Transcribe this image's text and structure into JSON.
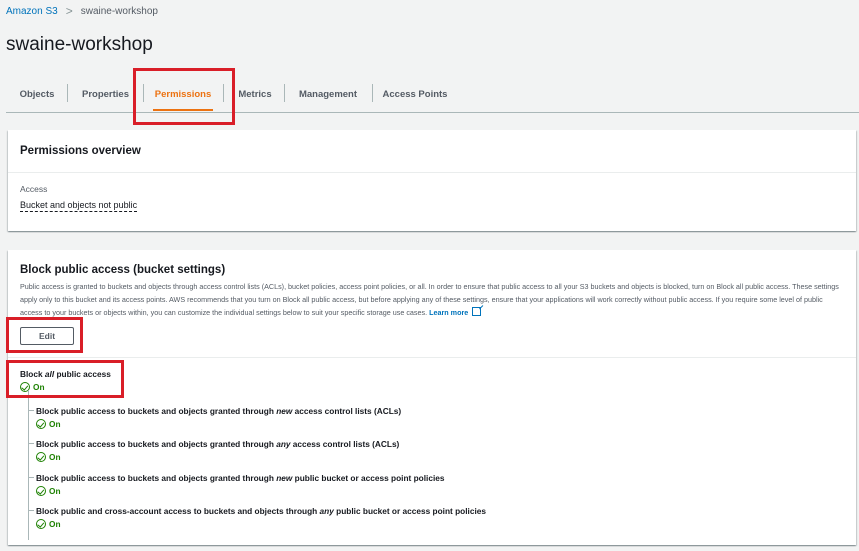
{
  "breadcrumb": {
    "root": "Amazon S3",
    "separator": ">",
    "current": "swaine-workshop"
  },
  "page": {
    "title": "swaine-workshop"
  },
  "tabs": [
    {
      "label": "Objects",
      "active": false
    },
    {
      "label": "Properties",
      "active": false
    },
    {
      "label": "Permissions",
      "active": true
    },
    {
      "label": "Metrics",
      "active": false
    },
    {
      "label": "Management",
      "active": false
    },
    {
      "label": "Access Points",
      "active": false
    }
  ],
  "permissions_overview": {
    "title": "Permissions overview",
    "access_label": "Access",
    "access_value": "Bucket and objects not public"
  },
  "block_public_access": {
    "title": "Block public access (bucket settings)",
    "description": "Public access is granted to buckets and objects through access control lists (ACLs), bucket policies, access point policies, or all. In order to ensure that public access to all your S3 buckets and objects is blocked, turn on Block all public access. These settings apply only to this bucket and its access points. AWS recommends that you turn on Block all public access, but before applying any of these settings, ensure that your applications will work correctly without public access. If you require some level of public access to your buckets or objects within, you can customize the individual settings below to suit your specific storage use cases.",
    "learn_more": "Learn more",
    "edit_label": "Edit",
    "main_setting": {
      "prefix": "Block ",
      "emphasis": "all",
      "suffix": " public access",
      "status": "On"
    },
    "settings": [
      {
        "prefix": "Block public access to buckets and objects granted through ",
        "emphasis": "new",
        "suffix": " access control lists (ACLs)",
        "status": "On"
      },
      {
        "prefix": "Block public access to buckets and objects granted through ",
        "emphasis": "any",
        "suffix": " access control lists (ACLs)",
        "status": "On"
      },
      {
        "prefix": "Block public access to buckets and objects granted through ",
        "emphasis": "new",
        "suffix": " public bucket or access point policies",
        "status": "On"
      },
      {
        "prefix": "Block public and cross-account access to buckets and objects through ",
        "emphasis": "any",
        "suffix": " public bucket or access point policies",
        "status": "On"
      }
    ]
  },
  "colors": {
    "accent": "#ec7211",
    "link": "#0073bb",
    "success": "#1d8102",
    "highlight": "#d91e28"
  }
}
